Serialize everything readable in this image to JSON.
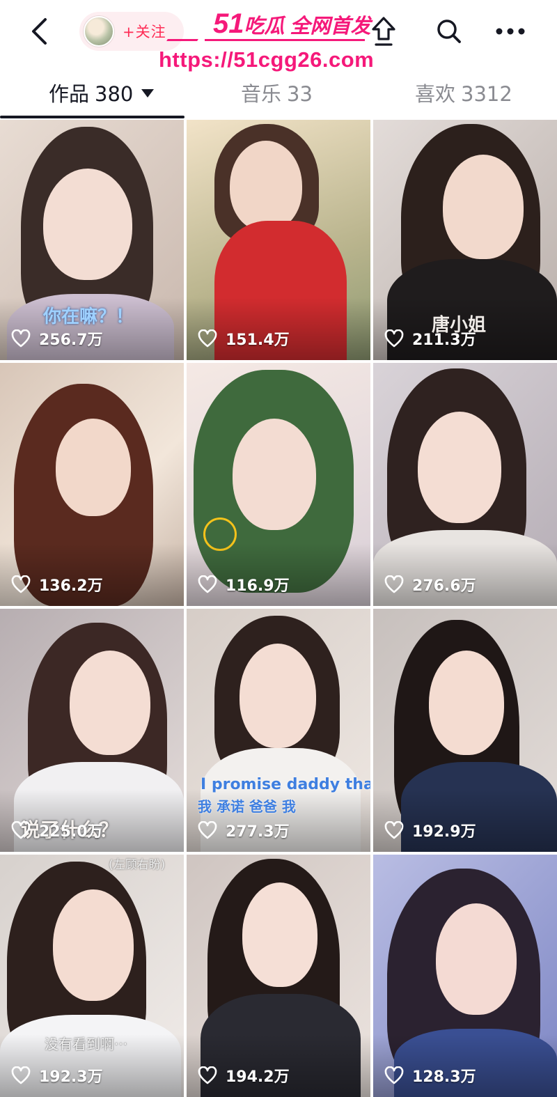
{
  "header": {
    "follow_label": "+关注",
    "icons": [
      "back-icon",
      "share-icon",
      "search-icon",
      "more-icon"
    ]
  },
  "watermark": {
    "prefix": "51",
    "title": "吃瓜 全网首发",
    "url": "https://51cgg26.com",
    "color": "#f5197a"
  },
  "tabs": [
    {
      "label": "作品",
      "count": "380",
      "active": true
    },
    {
      "label": "音乐",
      "count": "33",
      "active": false
    },
    {
      "label": "喜欢",
      "count": "3312",
      "active": false
    }
  ],
  "videos": [
    {
      "likes": "256.7万",
      "caption": "你在嘛？！"
    },
    {
      "likes": "151.4万",
      "caption": ""
    },
    {
      "likes": "211.3万",
      "caption": "唐小姐"
    },
    {
      "likes": "136.2万",
      "caption": ""
    },
    {
      "likes": "116.9万",
      "caption": ""
    },
    {
      "likes": "276.6万",
      "caption": ""
    },
    {
      "likes": "225.0万",
      "caption": "说了什么？"
    },
    {
      "likes": "277.3万",
      "caption": "I promise daddy that",
      "caption2": "我  承诺  爸爸  我"
    },
    {
      "likes": "192.9万",
      "caption": ""
    },
    {
      "likes": "192.3万",
      "caption": "没有看到啊···",
      "caption_top": "(左顾右盼)"
    },
    {
      "likes": "194.2万",
      "caption": ""
    },
    {
      "likes": "128.3万",
      "caption": ""
    }
  ],
  "colors": {
    "accent": "#fe2c55",
    "follow_bg": "#fdeef1",
    "text": "#161823",
    "muted": "#8a8b91"
  }
}
